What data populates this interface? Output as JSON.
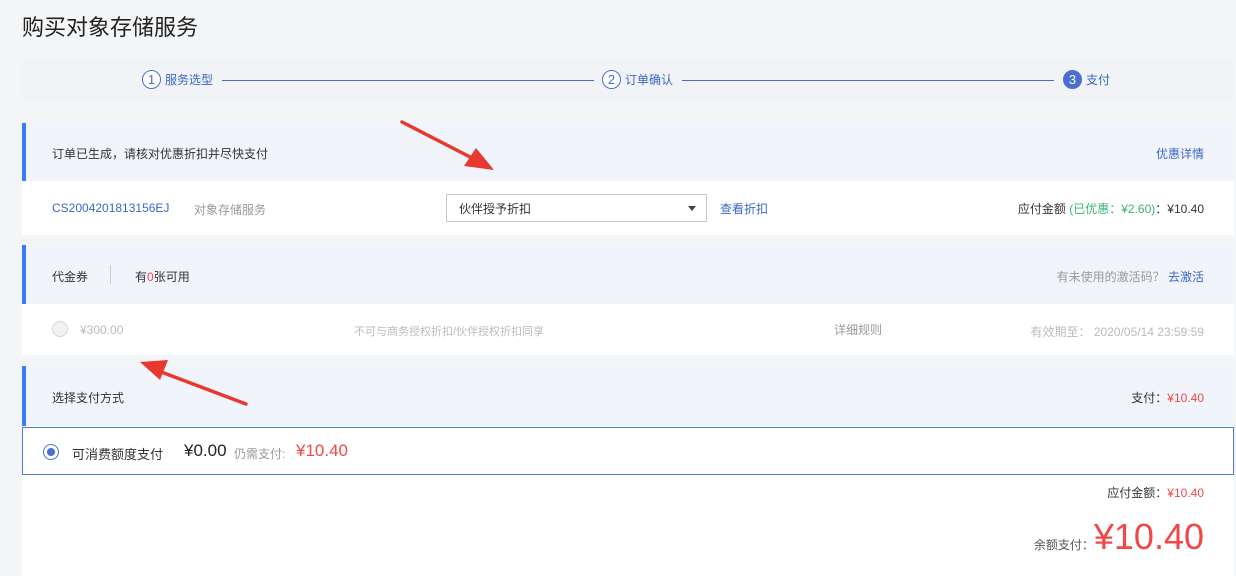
{
  "page": {
    "title": "购买对象存储服务"
  },
  "steps": [
    {
      "num": "1",
      "label": "服务选型"
    },
    {
      "num": "2",
      "label": "订单确认"
    },
    {
      "num": "3",
      "label": "支付"
    }
  ],
  "order": {
    "notice": "订单已生成，请核对优惠折扣并尽快支付",
    "discount_detail_link": "优惠详情",
    "order_id": "CS2004201813156EJ",
    "service_name": "对象存储服务",
    "discount_select_value": "伙伴授予折扣",
    "view_discount_link": "查看折扣",
    "payable_label": "应付金额",
    "discount_prefix": "(已优惠：",
    "discount_amount": "¥2.60",
    "discount_suffix": ")",
    "payable_colon": "：",
    "payable_amount": "¥10.40"
  },
  "voucher": {
    "title": "代金券",
    "avail_prefix": "有",
    "avail_count": "0",
    "avail_suffix": "张可用",
    "unused_code_text": "有未使用的激活码？",
    "activate_link": "去激活",
    "item_amount": "¥300.00",
    "item_desc": "不可与商务授权折扣/伙伴授权折扣同享",
    "item_rules": "详细规则",
    "item_expiry": "有效期至： 2020/05/14 23:59:59"
  },
  "payment": {
    "title": "选择支付方式",
    "pay_label": "支付：",
    "pay_amount": "¥10.40",
    "method_label": "可消费额度支付",
    "method_balance": "¥0.00",
    "still_need_label": "仍需支付:",
    "still_need_amount": "¥10.40"
  },
  "summary": {
    "payable_label": "应付金额：",
    "payable_amount": "¥10.40",
    "balance_label": "余额支付：",
    "balance_amount": "¥10.40"
  },
  "colors": {
    "accent": "#4a6fd0",
    "price": "#f04848",
    "discount": "#3cb371",
    "annotation_arrow": "#e8382f"
  }
}
